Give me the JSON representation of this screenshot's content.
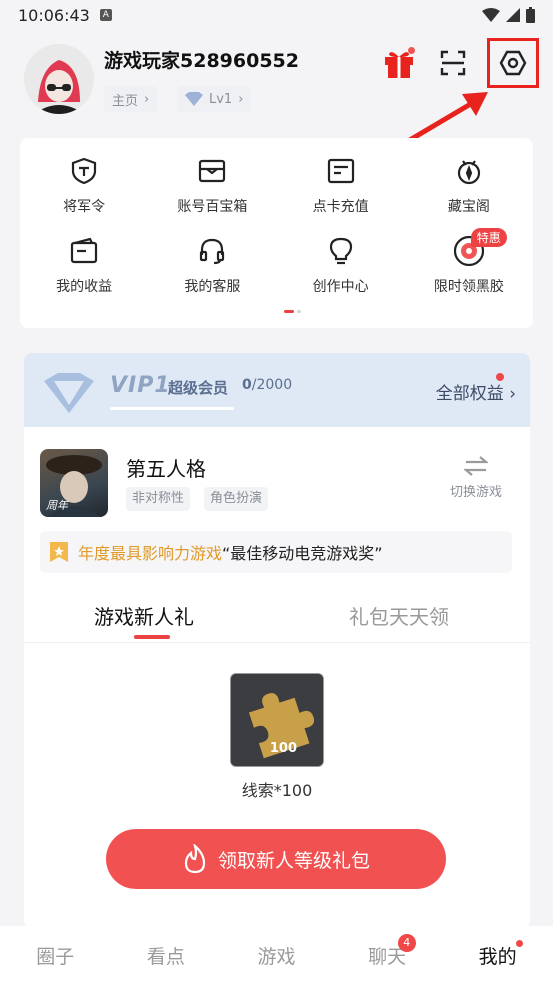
{
  "status_bar": {
    "time": "10:06:43",
    "notif_icon": "A"
  },
  "profile": {
    "username": "游戏玩家528960552",
    "home_chip": "主页",
    "level_chip": "Lv1"
  },
  "top_icons": {
    "gift": "gift-icon",
    "scan": "scan-icon",
    "settings": "settings-icon"
  },
  "menu": {
    "items": [
      {
        "label": "将军令",
        "icon": "shield-t-icon"
      },
      {
        "label": "账号百宝箱",
        "icon": "treasure-box-icon"
      },
      {
        "label": "点卡充值",
        "icon": "card-icon"
      },
      {
        "label": "藏宝阁",
        "icon": "treasure-pavilion-icon"
      },
      {
        "label": "我的收益",
        "icon": "wallet-icon"
      },
      {
        "label": "我的客服",
        "icon": "headset-icon"
      },
      {
        "label": "创作中心",
        "icon": "bulb-icon"
      },
      {
        "label": "限时领黑胶",
        "icon": "vinyl-icon"
      }
    ],
    "special_badge": "特惠"
  },
  "vip": {
    "title": "VIP1",
    "subtitle": "超级会员",
    "progress_current": "0",
    "progress_total": "/2000",
    "rights_label": "全部权益"
  },
  "game": {
    "name": "第五人格",
    "tags": [
      "非对称性",
      "角色扮演"
    ],
    "switch_label": "切换游戏",
    "thumb_badge": "周年"
  },
  "award": {
    "highlight": "年度最具影响力游戏",
    "text": "“最佳移动电竞游戏奖”"
  },
  "tabs": {
    "active": "游戏新人礼",
    "inactive": "礼包天天领"
  },
  "reward": {
    "count": "100",
    "label": "线索*100"
  },
  "claim_button": "领取新人等级礼包",
  "bottom_nav": {
    "items": [
      "圈子",
      "看点",
      "游戏",
      "聊天",
      "我的"
    ],
    "chat_badge": "4"
  },
  "colors": {
    "accent": "#f25151",
    "vip_bg": "#dfe9f6",
    "highlight_box": "#e8231d"
  }
}
